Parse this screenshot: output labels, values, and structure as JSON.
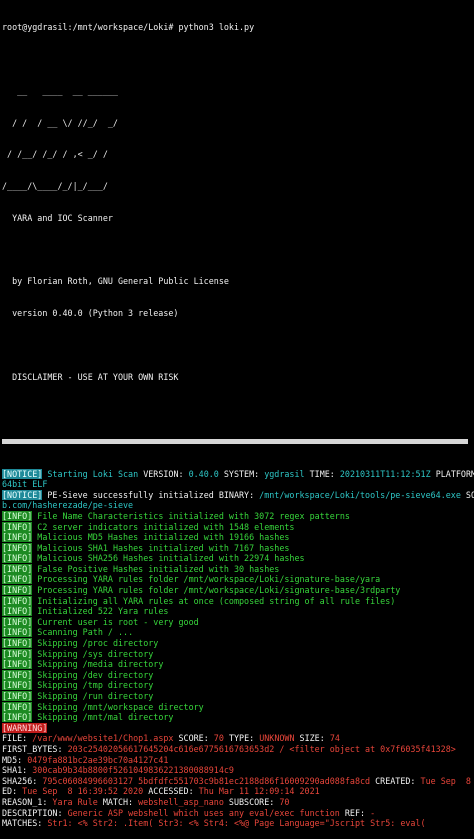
{
  "prompt": "root@ygdrasil:/mnt/workspace/Loki# python3 loki.py",
  "banner": {
    "logo": [
      "   __   ____  __ ______",
      "  / /  / __ \\/ //_/  _/",
      " / /__/ /_/ / ,< _/ /",
      "/____/\\____/_/|_/___/"
    ],
    "subtitle": "  YARA and IOC Scanner",
    "author": "  by Florian Roth, GNU General Public License",
    "version": "  version 0.40.0 (Python 3 release)",
    "disclaimer": "  DISCLAIMER - USE AT YOUR OWN RISK"
  },
  "lines": [
    {
      "tag": "NOTICE",
      "parts": [
        {
          "c": "cyan",
          "t": " Starting Loki Scan "
        },
        {
          "c": "white",
          "t": "VERSION: "
        },
        {
          "c": "cyan",
          "t": "0.40.0 "
        },
        {
          "c": "white",
          "t": "SYSTEM: "
        },
        {
          "c": "cyan",
          "t": "ygdrasil "
        },
        {
          "c": "white",
          "t": "TIME: "
        },
        {
          "c": "cyan",
          "t": "20210311T11:12:51Z "
        },
        {
          "c": "white",
          "t": "PLATFORM:     PROC:  ARCH: "
        }
      ]
    },
    {
      "tag": "",
      "parts": [
        {
          "c": "cyan",
          "t": "64bit ELF"
        }
      ]
    },
    {
      "tag": "NOTICE",
      "parts": [
        {
          "c": "white",
          "t": " PE-Sieve successfully initialized "
        },
        {
          "c": "white",
          "t": "BINARY: "
        },
        {
          "c": "cyan",
          "t": "/mnt/workspace/Loki/tools/pe-sieve64.exe "
        },
        {
          "c": "white",
          "t": "SOURCE: "
        },
        {
          "c": "cyan",
          "t": "https://githu"
        }
      ]
    },
    {
      "tag": "",
      "parts": [
        {
          "c": "cyan",
          "t": "b.com/hasherezade/pe-sieve"
        }
      ]
    },
    {
      "tag": "INFO",
      "parts": [
        {
          "c": "green",
          "t": " File Name Characteristics initialized with 3072 regex patterns"
        }
      ]
    },
    {
      "tag": "INFO",
      "parts": [
        {
          "c": "green",
          "t": " C2 server indicators initialized with 1548 elements"
        }
      ]
    },
    {
      "tag": "INFO",
      "parts": [
        {
          "c": "green",
          "t": " Malicious MD5 Hashes initialized with 19166 hashes"
        }
      ]
    },
    {
      "tag": "INFO",
      "parts": [
        {
          "c": "green",
          "t": " Malicious SHA1 Hashes initialized with 7167 hashes"
        }
      ]
    },
    {
      "tag": "INFO",
      "parts": [
        {
          "c": "green",
          "t": " Malicious SHA256 Hashes initialized with 22974 hashes"
        }
      ]
    },
    {
      "tag": "INFO",
      "parts": [
        {
          "c": "green",
          "t": " False Positive Hashes initialized with 30 hashes"
        }
      ]
    },
    {
      "tag": "INFO",
      "parts": [
        {
          "c": "green",
          "t": " Processing YARA rules folder /mnt/workspace/Loki/signature-base/yara"
        }
      ]
    },
    {
      "tag": "INFO",
      "parts": [
        {
          "c": "green",
          "t": " Processing YARA rules folder /mnt/workspace/Loki/signature-base/3rdparty"
        }
      ]
    },
    {
      "tag": "INFO",
      "parts": [
        {
          "c": "green",
          "t": " Initializing all YARA rules at once (composed string of all rule files)"
        }
      ]
    },
    {
      "tag": "INFO",
      "parts": [
        {
          "c": "green",
          "t": " Initialized 522 Yara rules"
        }
      ]
    },
    {
      "tag": "INFO",
      "parts": [
        {
          "c": "green",
          "t": " Current user is root - very good"
        }
      ]
    },
    {
      "tag": "INFO",
      "parts": [
        {
          "c": "green",
          "t": " Scanning Path / ..."
        }
      ]
    },
    {
      "tag": "INFO",
      "parts": [
        {
          "c": "green",
          "t": " Skipping /proc directory"
        }
      ]
    },
    {
      "tag": "INFO",
      "parts": [
        {
          "c": "green",
          "t": " Skipping /sys directory"
        }
      ]
    },
    {
      "tag": "INFO",
      "parts": [
        {
          "c": "green",
          "t": " Skipping /media directory"
        }
      ]
    },
    {
      "tag": "INFO",
      "parts": [
        {
          "c": "green",
          "t": " Skipping /dev directory"
        }
      ]
    },
    {
      "tag": "INFO",
      "parts": [
        {
          "c": "green",
          "t": " Skipping /tmp directory"
        }
      ]
    },
    {
      "tag": "INFO",
      "parts": [
        {
          "c": "green",
          "t": " Skipping /run directory"
        }
      ]
    },
    {
      "tag": "INFO",
      "parts": [
        {
          "c": "green",
          "t": " Skipping /mnt/workspace directory"
        }
      ]
    },
    {
      "tag": "INFO",
      "parts": [
        {
          "c": "green",
          "t": " Skipping /mnt/mal directory"
        }
      ]
    },
    {
      "tag": "WARNING",
      "parts": []
    },
    {
      "tag": "",
      "parts": [
        {
          "c": "white",
          "t": "FILE: "
        },
        {
          "c": "red",
          "t": "/var/www/website1/Chop1.aspx "
        },
        {
          "c": "white",
          "t": "SCORE: "
        },
        {
          "c": "red",
          "t": "70 "
        },
        {
          "c": "white",
          "t": "TYPE: "
        },
        {
          "c": "red",
          "t": "UNKNOWN "
        },
        {
          "c": "white",
          "t": "SIZE: "
        },
        {
          "c": "red",
          "t": "74"
        }
      ]
    },
    {
      "tag": "",
      "parts": [
        {
          "c": "white",
          "t": "FIRST_BYTES: "
        },
        {
          "c": "red",
          "t": "203c25402056617645204c616e6775616763653d2 / <filter object at 0x7f6035f41328>"
        }
      ]
    },
    {
      "tag": "",
      "parts": [
        {
          "c": "white",
          "t": "MD5: "
        },
        {
          "c": "red",
          "t": "0479fa881bc2ae39bc70a4127c41"
        }
      ]
    },
    {
      "tag": "",
      "parts": [
        {
          "c": "white",
          "t": "SHA1: "
        },
        {
          "c": "red",
          "t": "300cab9b34b8800f5261049836221380088914c9"
        }
      ]
    },
    {
      "tag": "",
      "parts": [
        {
          "c": "white",
          "t": "SHA256: "
        },
        {
          "c": "red",
          "t": "795c06084996603127 5bdfdfc551703c9b81ec2188d86f16009290ad088fa8cd "
        },
        {
          "c": "white",
          "t": "CREATED: "
        },
        {
          "c": "red",
          "t": "Tue Sep  8 16:39:52 2020"
        }
      ]
    },
    {
      "tag": "",
      "parts": [
        {
          "c": "white",
          "t": "ED: "
        },
        {
          "c": "red",
          "t": "Tue Sep  8 16:39:52 2020 "
        },
        {
          "c": "white",
          "t": "ACCESSED: "
        },
        {
          "c": "red",
          "t": "Thu Mar 11 12:09:14 2021"
        }
      ]
    },
    {
      "tag": "",
      "parts": [
        {
          "c": "white",
          "t": "REASON_1: "
        },
        {
          "c": "red",
          "t": "Yara Rule "
        },
        {
          "c": "white",
          "t": "MATCH: "
        },
        {
          "c": "red",
          "t": "webshell_asp_nano "
        },
        {
          "c": "white",
          "t": "SUBSCORE: "
        },
        {
          "c": "red",
          "t": "70"
        }
      ]
    },
    {
      "tag": "",
      "parts": [
        {
          "c": "white",
          "t": "DESCRIPTION: "
        },
        {
          "c": "red",
          "t": "Generic ASP webshell which uses any eval/exec function "
        },
        {
          "c": "white",
          "t": "REF: "
        },
        {
          "c": "red",
          "t": "-"
        }
      ]
    },
    {
      "tag": "",
      "parts": [
        {
          "c": "white",
          "t": "MATCHES: "
        },
        {
          "c": "red",
          "t": "Str1: <% Str2: .Item( Str3: <% Str4: <%@ Page Language=\"Jscript Str5: eval("
        }
      ]
    }
  ]
}
